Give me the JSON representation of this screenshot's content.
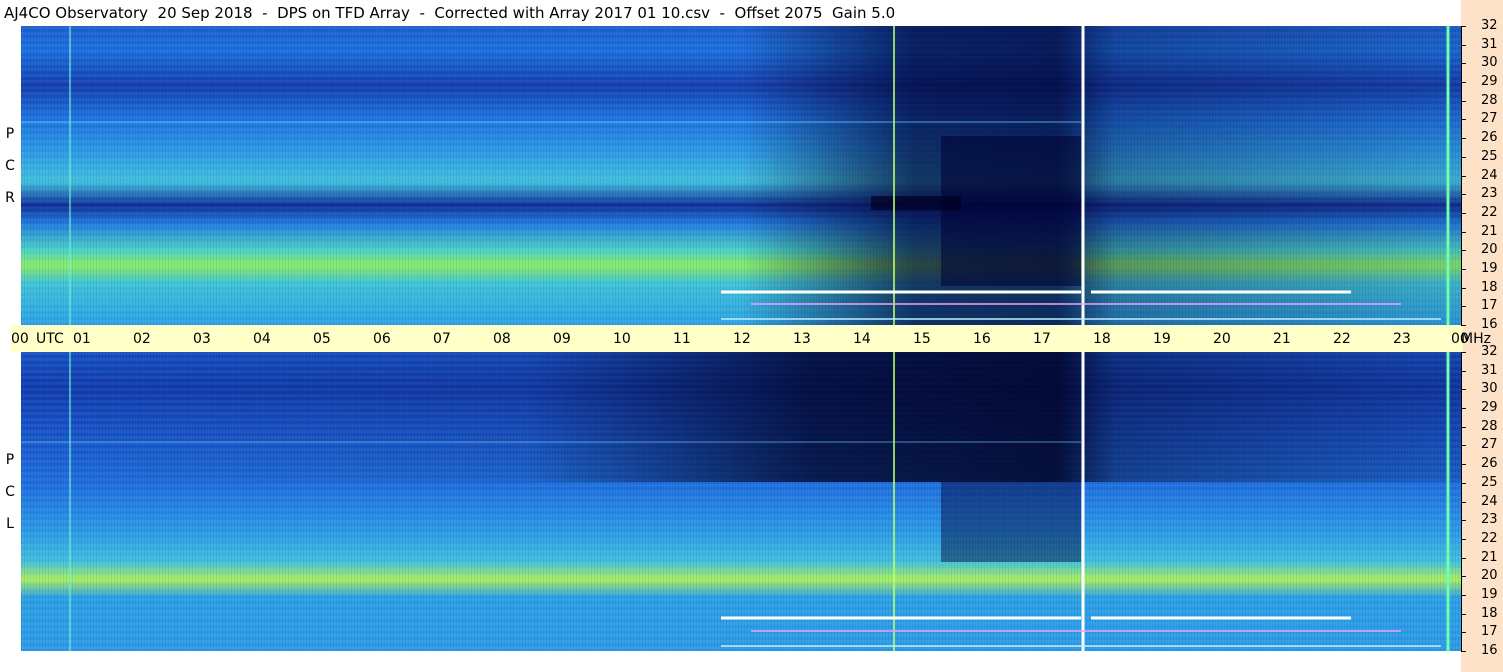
{
  "header": {
    "title": "AJ4CO Observatory  20 Sep 2018  -  DPS on TFD Array  -  Corrected with Array 2017 01 10.csv  -  Offset 2075  Gain 5.0"
  },
  "panels": {
    "rcp": {
      "label_letters": [
        "P",
        "C",
        "R"
      ]
    },
    "lcp": {
      "label_letters": [
        "P",
        "C",
        "L"
      ]
    }
  },
  "time_axis": {
    "labels": [
      "00",
      "UTC",
      "01",
      "02",
      "03",
      "04",
      "05",
      "06",
      "07",
      "08",
      "09",
      "10",
      "11",
      "12",
      "13",
      "14",
      "15",
      "16",
      "17",
      "18",
      "19",
      "20",
      "21",
      "22",
      "23",
      "00",
      "MHz"
    ]
  },
  "freq_axis": {
    "labels": [
      "32",
      "31",
      "30",
      "29",
      "28",
      "27",
      "26",
      "25",
      "24",
      "23",
      "22",
      "21",
      "20",
      "19",
      "18",
      "17",
      "16"
    ]
  },
  "colors": {
    "background": "#ffffff",
    "time_bar": "#ffffc8",
    "freq_axis_bg": "#fde2c8",
    "spectrogram_low": "#000066",
    "spectrogram_mid": "#1d6fe0",
    "spectrogram_high": "#66ff66"
  }
}
